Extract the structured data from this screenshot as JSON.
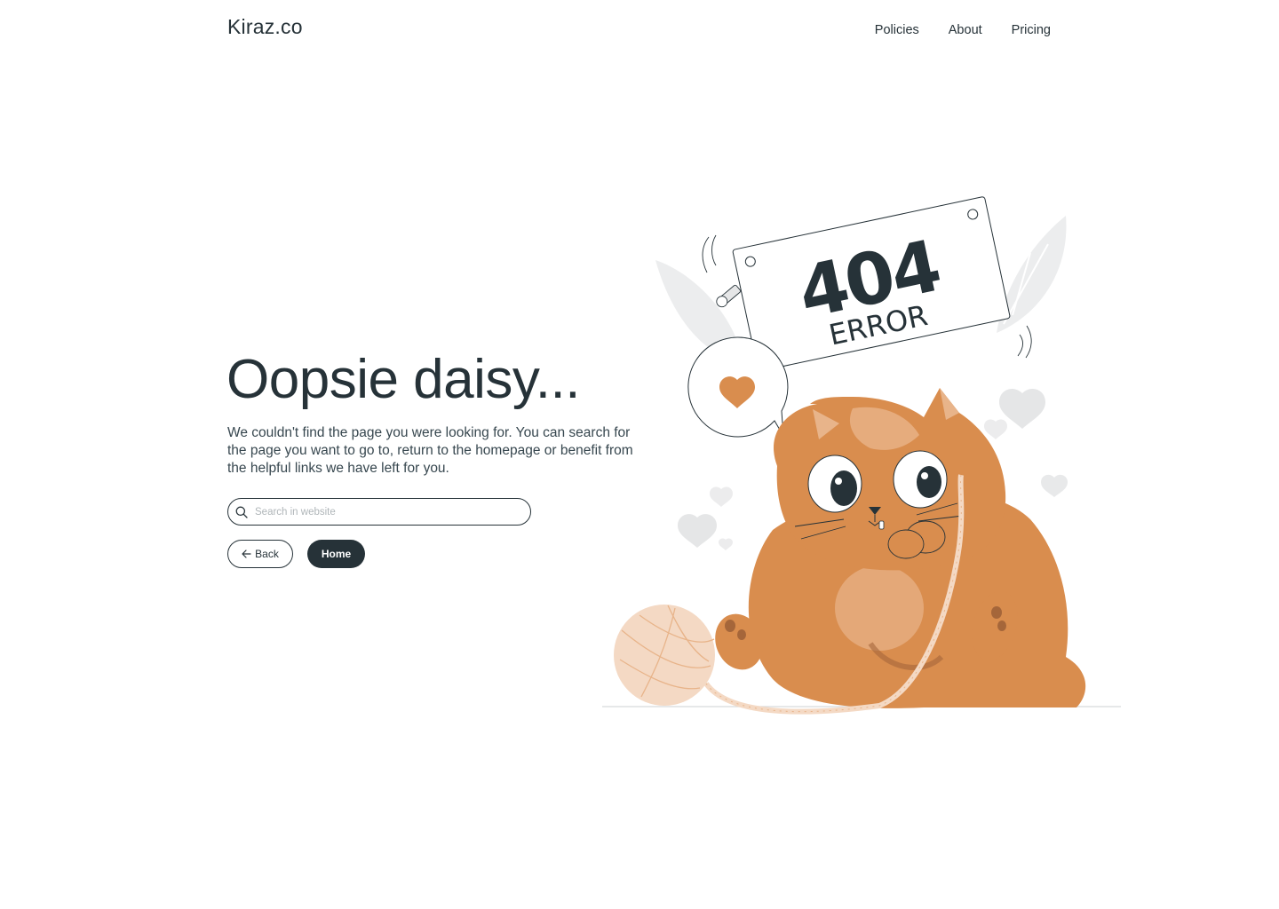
{
  "header": {
    "logo": "Kiraz.co",
    "nav": [
      "Policies",
      "About",
      "Pricing"
    ]
  },
  "main": {
    "headline": "Oopsie daisy...",
    "description": "We couldn't find the page you were looking for. You can search for the page you want to go to, return to the homepage or benefit from the helpful links we have left for you.",
    "search": {
      "placeholder": "Search in website",
      "value": ""
    },
    "back_label": "Back",
    "home_label": "Home"
  },
  "illustration": {
    "sign_code": "404",
    "sign_text": "ERROR",
    "colors": {
      "cat": "#D98D4E",
      "cat_light": "#E8B48A",
      "yarn": "#F4D9C4",
      "leaf": "#ECEDEE",
      "ink": "#263238"
    }
  },
  "colors": {
    "text": "#263238",
    "button_dark": "#263238",
    "background": "#FFFFFF"
  }
}
